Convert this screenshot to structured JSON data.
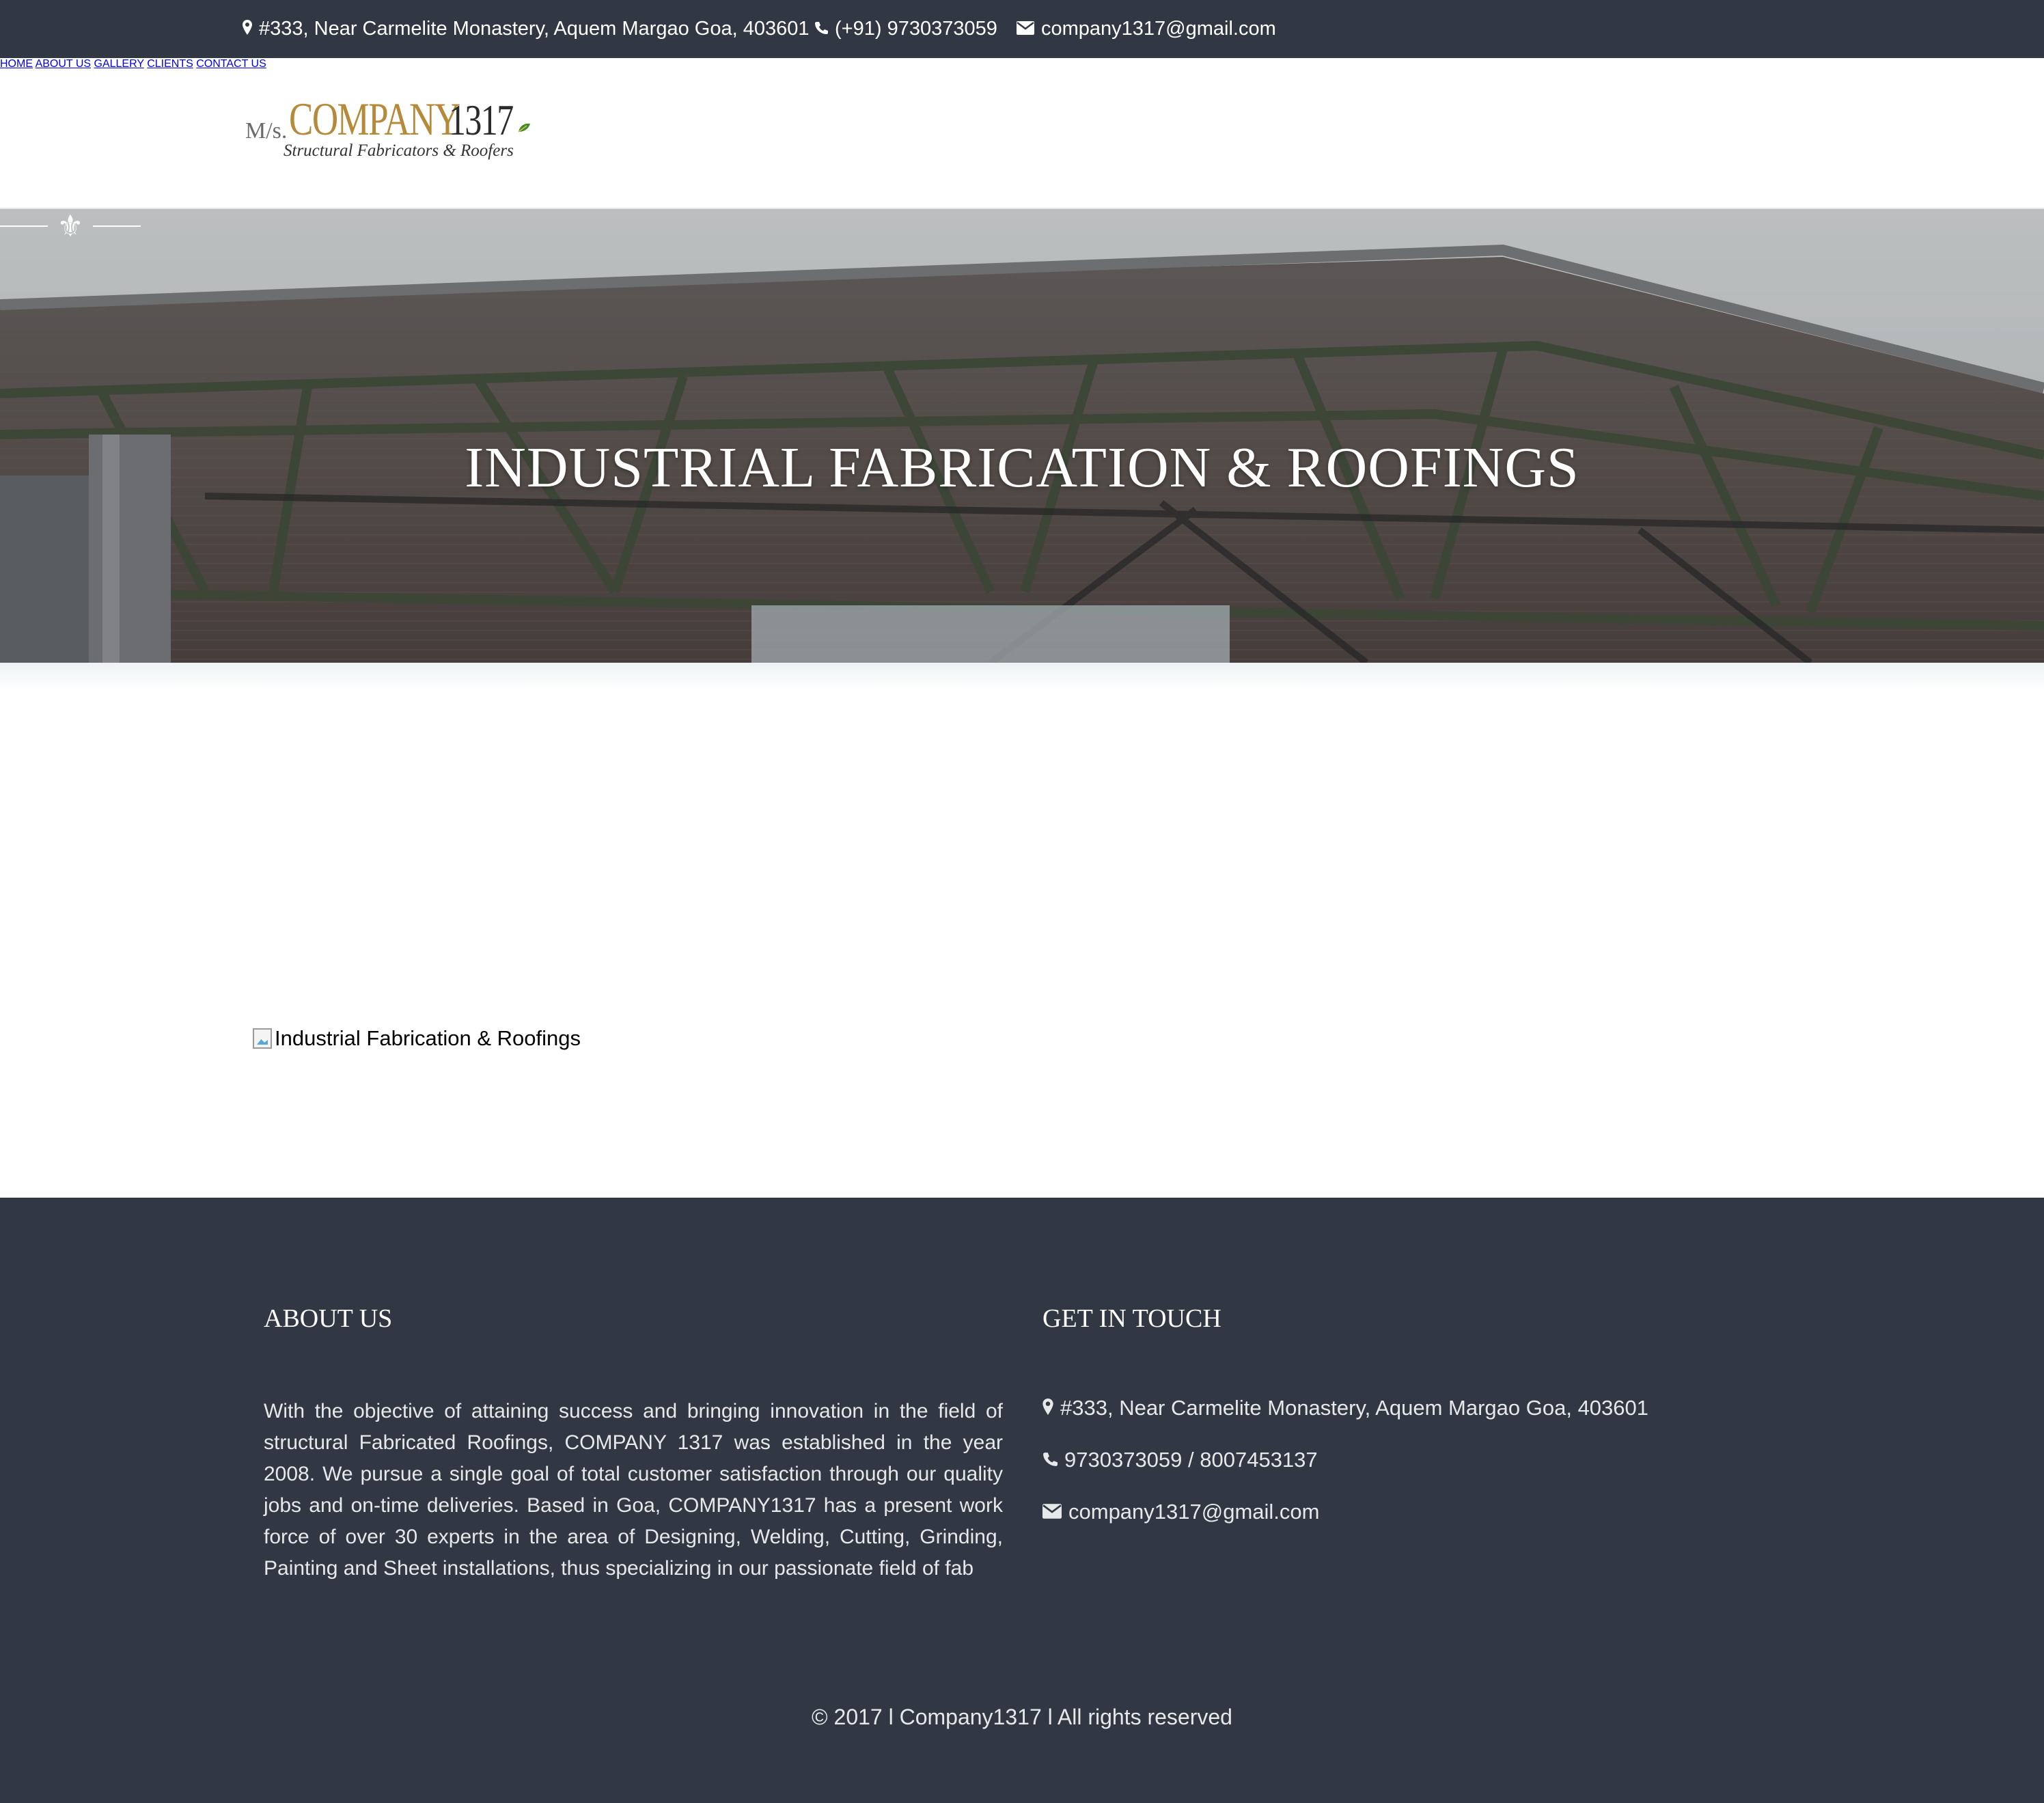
{
  "topbar": {
    "address": "#333, Near Carmelite Monastery, Aquem Margao Goa, 403601",
    "phone": "(+91) 9730373059",
    "email": "company1317@gmail.com",
    "address_icon": "map-marker-icon",
    "phone_icon": "phone-icon",
    "email_icon": "envelope-icon"
  },
  "logo": {
    "prefix": "M/s.",
    "name": "COMPANY",
    "number": "1317",
    "tagline": "Structural Fabricators & Roofers"
  },
  "nav": {
    "items": [
      "HOME",
      "ABOUT US",
      "GALLERY",
      "CLIENTS",
      "CONTACT US"
    ]
  },
  "hero": {
    "title": "INDUSTRIAL FABRICATION & ROOFINGS",
    "ornament": "⚜"
  },
  "content": {
    "image_alt": "Industrial Fabrication & Roofings"
  },
  "footer": {
    "about_heading": "ABOUT US",
    "about_text": "With the objective of attaining success and bringing innovation in the field of structural Fabricated Roofings, COMPANY 1317 was established in the year 2008. We pursue a single goal of total customer satisfaction through our quality jobs and on-time deliveries. Based in Goa, COMPANY1317 has a present work force of over 30 experts in the area of Designing, Welding, Cutting, Grinding, Painting and Sheet installations, thus specializing in our passionate field of fab",
    "contact_heading": "GET IN TOUCH",
    "address": "#333, Near Carmelite Monastery, Aquem Margao Goa, 403601",
    "phones": "9730373059 / 8007453137",
    "email": "company1317@gmail.com",
    "copyright": "© 2017 l Company1317 l All rights reserved"
  },
  "colors": {
    "dark_bar": "#323843",
    "logo_gold": "#b58a3a",
    "white": "#ffffff"
  }
}
